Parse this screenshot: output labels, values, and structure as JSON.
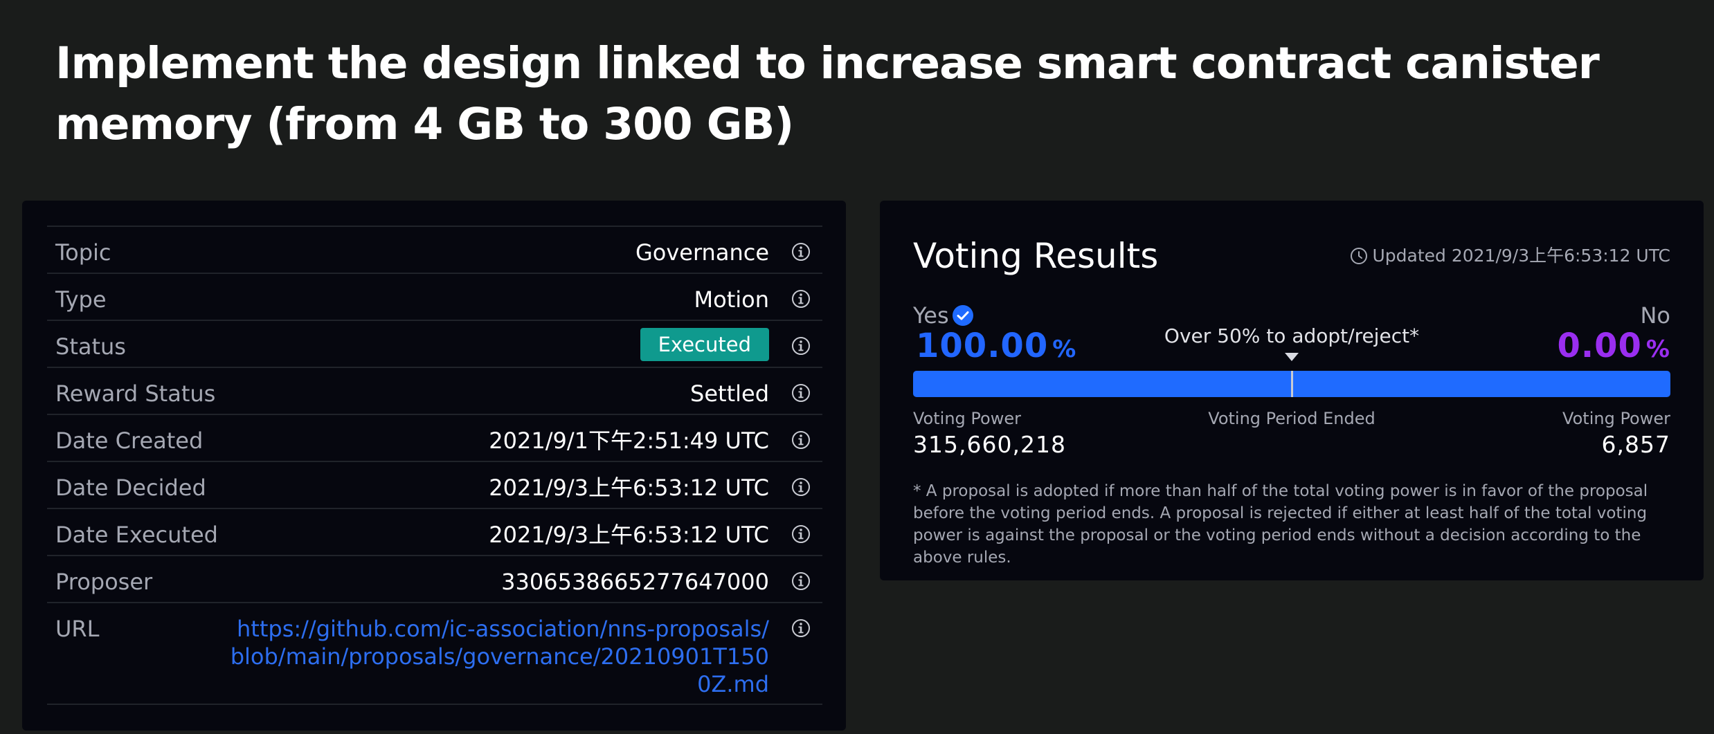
{
  "page": {
    "title": "Implement the design linked to increase smart contract canister memory (from 4 GB to 300 GB)"
  },
  "details": {
    "rows": [
      {
        "label": "Topic",
        "value": "Governance"
      },
      {
        "label": "Type",
        "value": "Motion"
      },
      {
        "label": "Status",
        "value": "Executed"
      },
      {
        "label": "Reward Status",
        "value": "Settled"
      },
      {
        "label": "Date Created",
        "value": "2021/9/1下午2:51:49 UTC"
      },
      {
        "label": "Date Decided",
        "value": "2021/9/3上午6:53:12 UTC"
      },
      {
        "label": "Date Executed",
        "value": "2021/9/3上午6:53:12 UTC"
      },
      {
        "label": "Proposer",
        "value": "3306538665277647000"
      },
      {
        "label": "URL",
        "value": "https://github.com/ic-association/nns-proposals/blob/main/proposals/governance/20210901T1500Z.md"
      }
    ],
    "info_icon": "info-circle-icon"
  },
  "voting": {
    "title": "Voting Results",
    "updated": "Updated 2021/9/3上午6:53:12 UTC",
    "yes_label": "Yes",
    "no_label": "No",
    "yes_percent": "100.00",
    "no_percent": "0.00",
    "percent_sign": "%",
    "yes_fraction": 1.0,
    "threshold_label": "Over 50% to adopt/reject*",
    "voting_power_label": "Voting Power",
    "period_label": "Voting Period Ended",
    "yes_power": "315,660,218",
    "no_power": "6,857",
    "footnote": "* A proposal is adopted if more than half of the total voting power is in favor of the proposal before the voting period ends. A proposal is rejected if either at least half of the total voting power is against the proposal or the voting period ends without a decision according to the above rules.",
    "colors": {
      "yes": "#1f6bff",
      "no": "#9a2ef0",
      "status_badge": "#0f9a8e"
    }
  }
}
